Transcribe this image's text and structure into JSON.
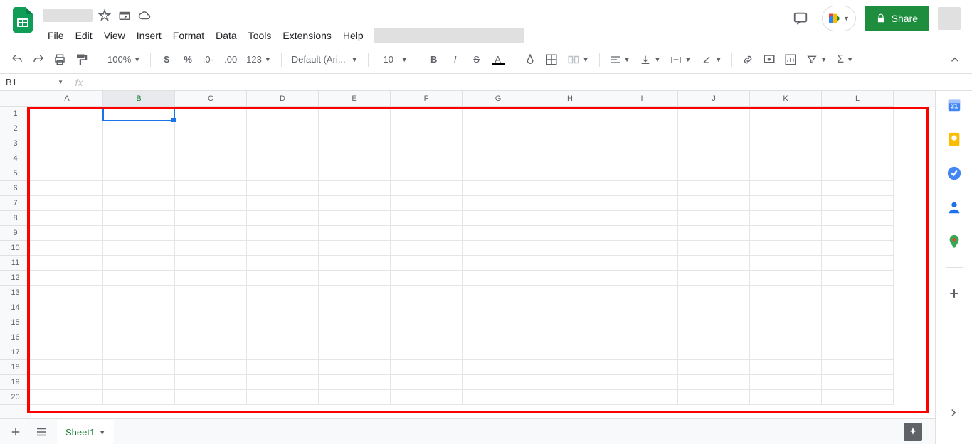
{
  "header": {
    "share_label": "Share"
  },
  "menu": {
    "file": "File",
    "edit": "Edit",
    "view": "View",
    "insert": "Insert",
    "format": "Format",
    "data": "Data",
    "tools": "Tools",
    "extensions": "Extensions",
    "help": "Help"
  },
  "toolbar": {
    "zoom": "100%",
    "number_format": "123",
    "font_name": "Default (Ari...",
    "font_size": "10"
  },
  "namebox": {
    "value": "B1"
  },
  "fx": "fx",
  "columns": [
    "A",
    "B",
    "C",
    "D",
    "E",
    "F",
    "G",
    "H",
    "I",
    "J",
    "K",
    "L"
  ],
  "rows": [
    "1",
    "2",
    "3",
    "4",
    "5",
    "6",
    "7",
    "8",
    "9",
    "10",
    "11",
    "12",
    "13",
    "14",
    "15",
    "16",
    "17",
    "18",
    "19",
    "20"
  ],
  "selected_col": "B",
  "selected_cell": "B1",
  "sheet_tabs": {
    "active": "Sheet1"
  }
}
